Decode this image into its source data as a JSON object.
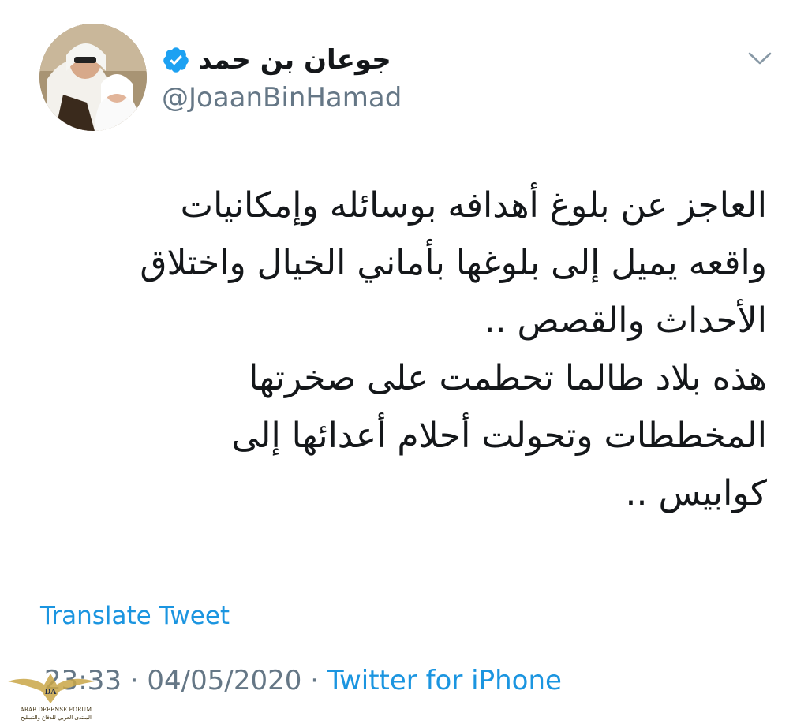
{
  "tweet": {
    "author": {
      "display_name": "جوعان بن حمد",
      "handle": "@JoaanBinHamad",
      "verified": true
    },
    "text_lines": [
      "العاجز عن بلوغ أهدافه بوسائله وإمكانيات",
      "واقعه يميل إلى بلوغها بأماني الخيال واختلاق",
      "الأحداث والقصص ..",
      "هذه بلاد طالما تحطمت على صخرتها",
      "المخططات وتحولت أحلام أعدائها إلى",
      "كوابيس .."
    ],
    "translate_label": "Translate Tweet",
    "time": "23:33",
    "separator": "·",
    "date": "04/05/2020",
    "source": "Twitter for iPhone"
  },
  "watermark": {
    "line1": "ARAB DEFENSE FORUM",
    "line2": "المنتدى العربي للدفاع والتسليح"
  },
  "colors": {
    "link": "#1b95e0",
    "secondary": "#657786",
    "text": "#14171a",
    "verified": "#1da1f2"
  },
  "icons": [
    "verified-badge-icon",
    "chevron-down-icon",
    "arab-defense-forum-logo"
  ]
}
